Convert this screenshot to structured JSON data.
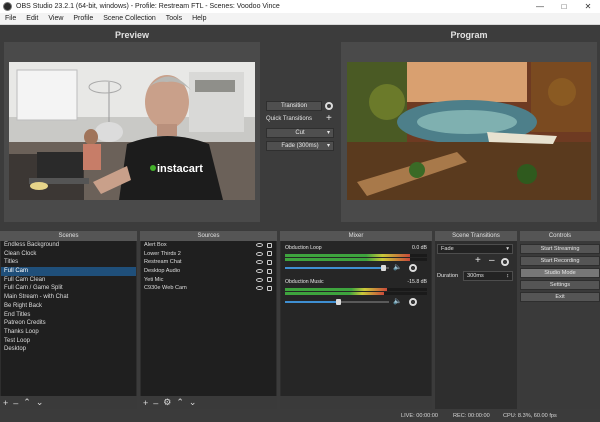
{
  "window": {
    "title": "OBS Studio 23.2.1 (64-bit, windows) - Profile: Restream FTL - Scenes: Voodoo Vince"
  },
  "menu": [
    "File",
    "Edit",
    "View",
    "Profile",
    "Scene Collection",
    "Tools",
    "Help"
  ],
  "preview": {
    "label": "Preview"
  },
  "program": {
    "label": "Program"
  },
  "transition_panel": {
    "transition_label": "Transition",
    "quick_transitions_label": "Quick Transitions",
    "cut_label": "Cut",
    "fade_label": "Fade (300ms)"
  },
  "scenes": {
    "title": "Scenes",
    "items": [
      "Endless Background",
      "Clean Clock",
      "Titles",
      "Full Cam",
      "Full Cam Clean",
      "Full Cam / Game Split",
      "Main Stream - with Chat",
      "Be Right Back",
      "End Titles",
      "Patreon Credits",
      "Thanks Loop",
      "Test Loop",
      "Desktop"
    ],
    "selected_index": 3
  },
  "sources": {
    "title": "Sources",
    "items": [
      "Alert Box",
      "Lower Thirds 2",
      "Restream Chat",
      "Desktop Audio",
      "Yeti Mic",
      "C930e Web Cam"
    ]
  },
  "mixer": {
    "title": "Mixer",
    "channels": [
      {
        "name": "Obduction Loop",
        "db_text": "0.0 dB",
        "level": 0.88,
        "volume": 0.93
      },
      {
        "name": "Obduction Music",
        "db_text": "-15.8 dB",
        "level": 0.72,
        "volume": 0.5
      }
    ]
  },
  "scene_transitions": {
    "title": "Scene Transitions",
    "selected": "Fade",
    "duration_label": "Duration",
    "duration_value": "300ms"
  },
  "controls": {
    "title": "Controls",
    "start_streaming": "Start Streaming",
    "start_recording": "Start Recording",
    "studio_mode": "Studio Mode",
    "settings": "Settings",
    "exit": "Exit"
  },
  "status": {
    "live": "LIVE: 00:00:00",
    "rec": "REC: 00:00:00",
    "cpu": "CPU: 8.3%, 60.00 fps"
  },
  "icons": {
    "preview_content": "webcam-person-icon",
    "program_content": "game-scene-icon",
    "brand_shirt": "instacart"
  },
  "colors": {
    "selection": "#1f4f7a",
    "meter_green": "#3ea43e",
    "meter_yellow": "#c9c93a",
    "meter_red": "#c94a3a",
    "slider_blue": "#3f8fd2"
  }
}
